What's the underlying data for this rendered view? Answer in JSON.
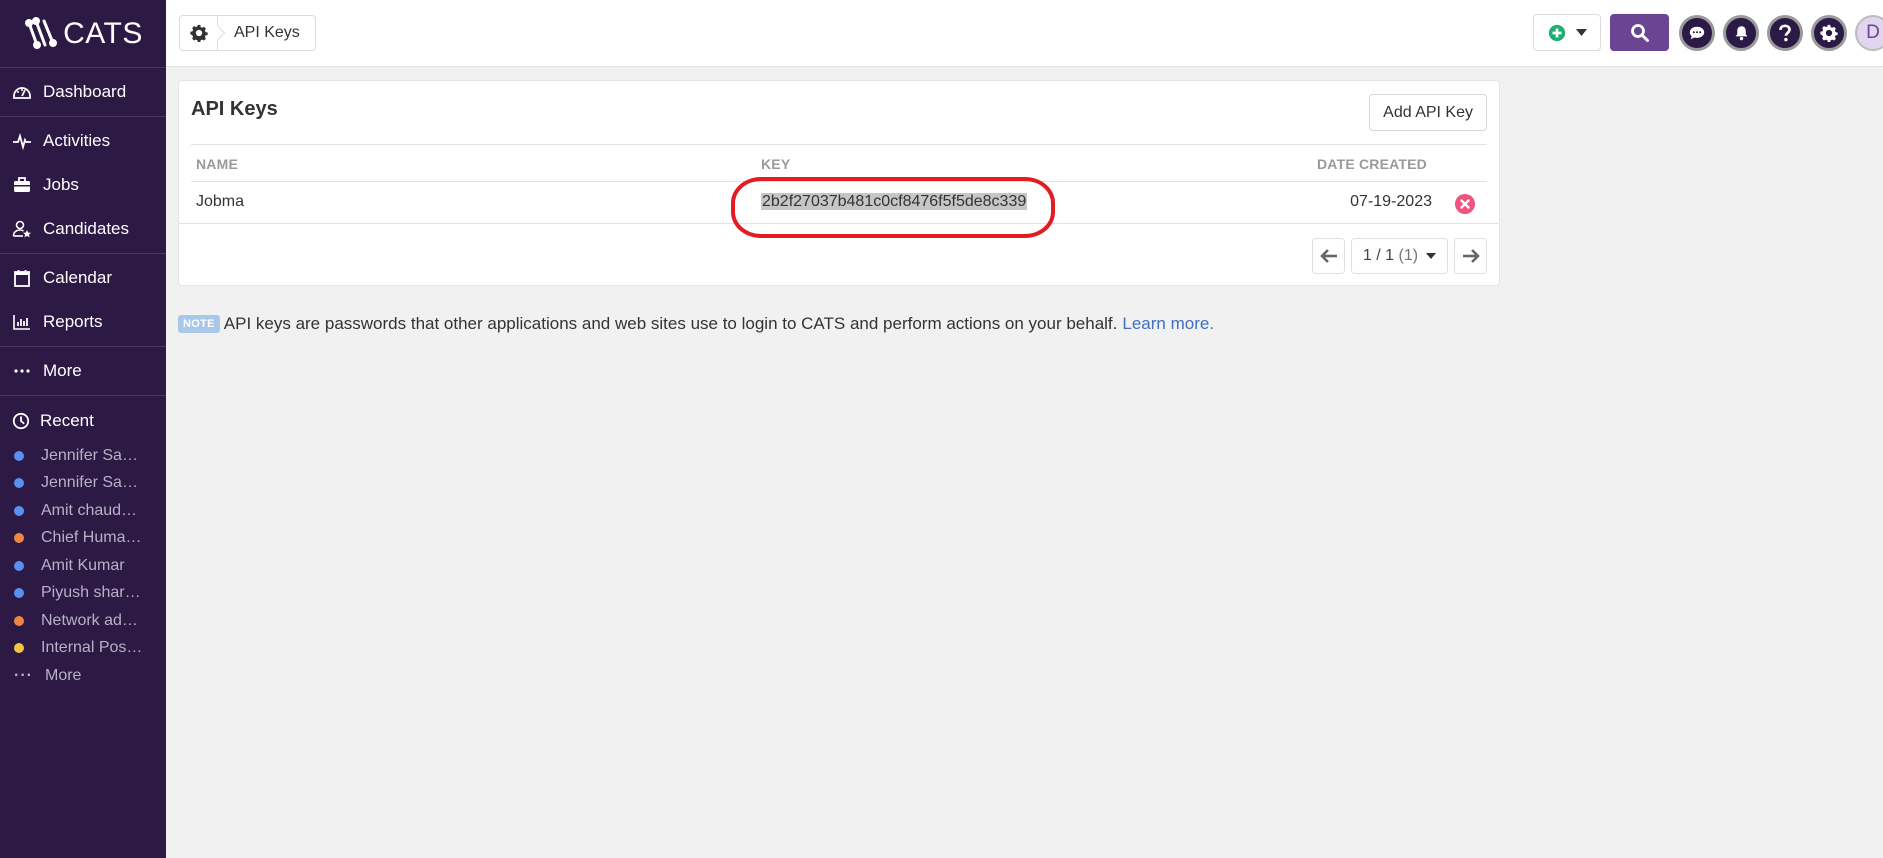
{
  "app": {
    "logo_text": "CATS"
  },
  "sidebar": {
    "nav_groups": [
      [
        {
          "label": "Dashboard",
          "icon": "dashboard-icon"
        }
      ],
      [
        {
          "label": "Activities",
          "icon": "activity-icon"
        },
        {
          "label": "Jobs",
          "icon": "briefcase-icon"
        },
        {
          "label": "Candidates",
          "icon": "candidates-icon"
        }
      ],
      [
        {
          "label": "Calendar",
          "icon": "calendar-icon"
        },
        {
          "label": "Reports",
          "icon": "reports-icon"
        }
      ],
      [
        {
          "label": "More",
          "icon": "more-icon"
        }
      ]
    ],
    "recent": {
      "label": "Recent",
      "items": [
        {
          "label": "Jennifer Sa…",
          "color": "#5b8ff0"
        },
        {
          "label": "Jennifer Sa…",
          "color": "#5b8ff0"
        },
        {
          "label": "Amit chaud…",
          "color": "#5b8ff0"
        },
        {
          "label": "Chief Huma…",
          "color": "#ef8743"
        },
        {
          "label": "Amit Kumar",
          "color": "#5b8ff0"
        },
        {
          "label": "Piyush shar…",
          "color": "#5b8ff0"
        },
        {
          "label": "Network ad…",
          "color": "#ef8743"
        },
        {
          "label": "Internal Pos…",
          "color": "#f5c542"
        }
      ],
      "more_label": "More"
    }
  },
  "topbar": {
    "breadcrumb": "API Keys",
    "avatar_initial": "D"
  },
  "card": {
    "title": "API Keys",
    "add_button": "Add API Key",
    "columns": {
      "name": "NAME",
      "key": "KEY",
      "date": "DATE CREATED"
    },
    "rows": [
      {
        "name": "Jobma",
        "key": "2b2f27037b481c0cf8476f5f5de8c339",
        "date": "07-19-2023"
      }
    ],
    "pagination": {
      "current": "1 / 1",
      "total": "(1)"
    }
  },
  "note": {
    "badge": "NOTE",
    "text": "API keys are passwords that other applications and web sites use to login to CATS and perform actions on your behalf.",
    "link": "Learn more."
  },
  "colors": {
    "sidebar_bg": "#2c1a45",
    "accent": "#6b4593",
    "delete": "#f0537b",
    "add": "#1cae73",
    "highlight": "#e31b23"
  }
}
